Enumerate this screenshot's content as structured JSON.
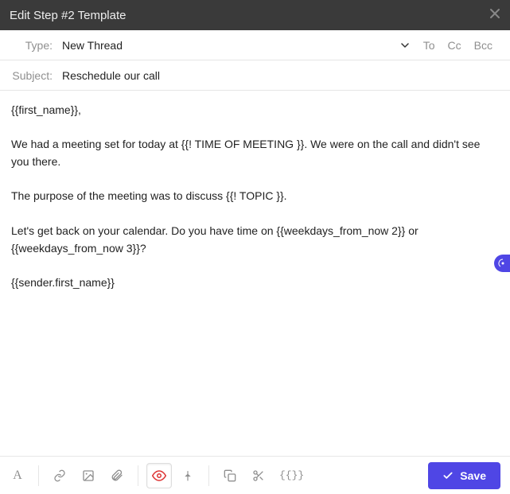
{
  "titlebar": {
    "title": "Edit Step #2 Template"
  },
  "type_row": {
    "label": "Type:",
    "value": "New Thread",
    "to": "To",
    "cc": "Cc",
    "bcc": "Bcc"
  },
  "subject_row": {
    "label": "Subject:",
    "value": "Reschedule our call"
  },
  "body": "{{first_name}},\n\nWe had a meeting set for today at {{! TIME OF MEETING }}. We were on the call and didn't see you there.\n\nThe purpose of the meeting was to discuss {{! TOPIC }}.\n\nLet's get back on your calendar. Do you have time on {{weekdays_from_now 2}} or {{weekdays_from_now 3}}?\n\n{{sender.first_name}}",
  "toolbar": {
    "font_label": "A",
    "token_btn": "{{}}",
    "save_label": "Save"
  }
}
